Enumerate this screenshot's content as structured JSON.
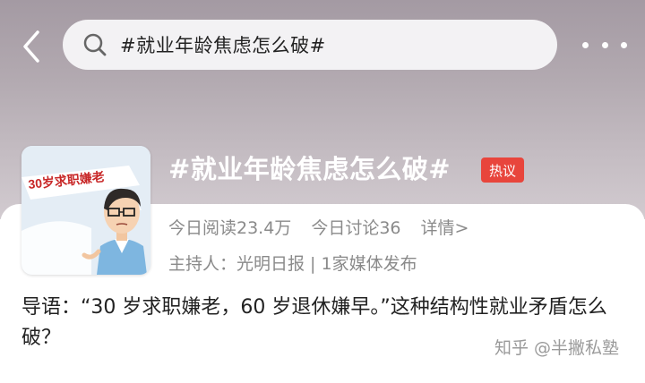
{
  "header": {
    "search_query": "#就业年龄焦虑怎么破#"
  },
  "topic": {
    "thumbnail_caption": "30岁求职嫌老",
    "title": "#就业年龄焦虑怎么破#",
    "badge": "热议",
    "read_today": "今日阅读23.4万",
    "discuss_today": "今日讨论36",
    "details_label": "详情>",
    "host_line": "主持人：光明日报 | 1家媒体发布"
  },
  "intro": {
    "text": "导语：“30 岁求职嫌老，60 岁退休嫌早。”这种结构性就业矛盾怎么破？"
  },
  "watermark": {
    "text": "知乎 @半撇私塾"
  },
  "colors": {
    "badge_bg": "#e8453c",
    "header_gradient_top": "#a49aa3",
    "muted_text": "#8a8a8a"
  },
  "icons": [
    "back-arrow-icon",
    "search-icon",
    "more-icon"
  ]
}
